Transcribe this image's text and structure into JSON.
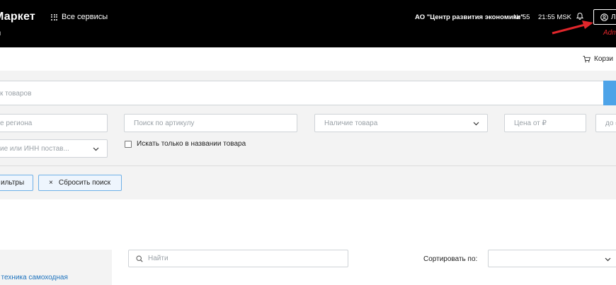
{
  "header": {
    "brand": "Маркет",
    "services_label": "Все сервисы",
    "subline": "ы",
    "org_name": "АО \"Центр развития экономики\"",
    "number": "№ 55",
    "time": "21:55 MSK",
    "user_initial": "Л",
    "admin_label": "Adm"
  },
  "cart": {
    "label": "Корзи"
  },
  "filters": {
    "main_search_placeholder": "ск товаров",
    "region_placeholder": "е региона",
    "article_placeholder": "Поиск по артикулу",
    "availability_placeholder": "Наличие товара",
    "price_from_placeholder": "Цена от ₽",
    "price_to_placeholder": "до ₽",
    "supplier_placeholder": "ие или ИНН постав...",
    "title_only_label": "Искать только в названии товара",
    "filters_button": "ильтры",
    "reset_button": "Сбросить поиск",
    "reset_icon": "×"
  },
  "catalog": {
    "side_link": "; техника самоходная",
    "find_placeholder": "Найти",
    "sort_label": "Сортировать по:"
  },
  "colors": {
    "header_bg": "#000000",
    "accent": "#4da3e8",
    "admin": "#e0262b",
    "link": "#1e73be"
  }
}
